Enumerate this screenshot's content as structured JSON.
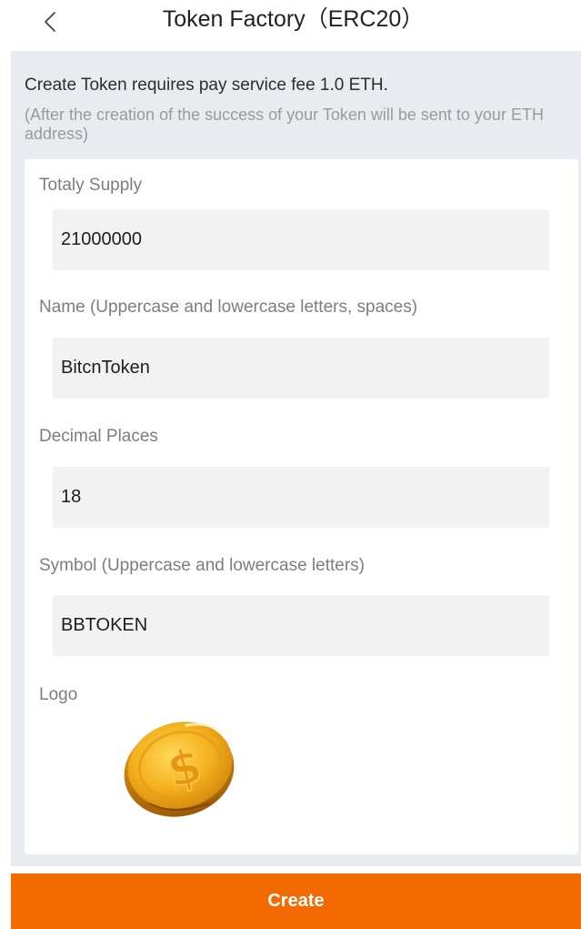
{
  "header": {
    "title": "Token Factory（ERC20）",
    "back_icon": "chevron-left-icon"
  },
  "notice": {
    "text": "Create Token requires pay service fee 1.0 ETH.",
    "subtext": "(After the creation of the success of your Token will be sent to your ETH address)"
  },
  "form": {
    "supply": {
      "label": "Totaly Supply",
      "value": "21000000"
    },
    "name": {
      "label": "Name (Uppercase and lowercase letters, spaces)",
      "value": "BitcnToken"
    },
    "decimals": {
      "label": "Decimal Places",
      "value": "18"
    },
    "symbol": {
      "label": "Symbol (Uppercase and lowercase letters)",
      "value": "BBTOKEN"
    },
    "logo": {
      "label": "Logo",
      "icon": "gold-dollar-coin-icon"
    }
  },
  "actions": {
    "create_label": "Create"
  },
  "colors": {
    "accent": "#f26a00",
    "page_bg": "#e8ebf0",
    "input_bg": "#f2f2f2",
    "coin_gold": "#f2b21c"
  }
}
